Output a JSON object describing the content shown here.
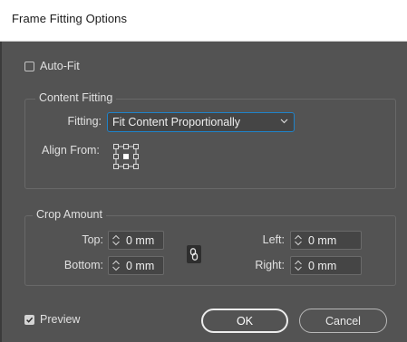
{
  "window": {
    "title": "Frame Fitting Options"
  },
  "auto_fit": {
    "label": "Auto-Fit",
    "checked": false
  },
  "content_fitting": {
    "group_title": "Content Fitting",
    "fitting_label": "Fitting:",
    "fitting_value": "Fit Content Proportionally",
    "align_from_label": "Align From:",
    "align_from_selected": "center"
  },
  "crop_amount": {
    "group_title": "Crop Amount",
    "top_label": "Top:",
    "top_value": "0 mm",
    "bottom_label": "Bottom:",
    "bottom_value": "0 mm",
    "left_label": "Left:",
    "left_value": "0 mm",
    "right_label": "Right:",
    "right_value": "0 mm",
    "link_icon": "chain-link-icon"
  },
  "preview": {
    "label": "Preview",
    "checked": true
  },
  "buttons": {
    "ok_label": "OK",
    "cancel_label": "Cancel"
  },
  "colors": {
    "panel_bg": "#535353",
    "focus_accent": "#1f83c9"
  }
}
